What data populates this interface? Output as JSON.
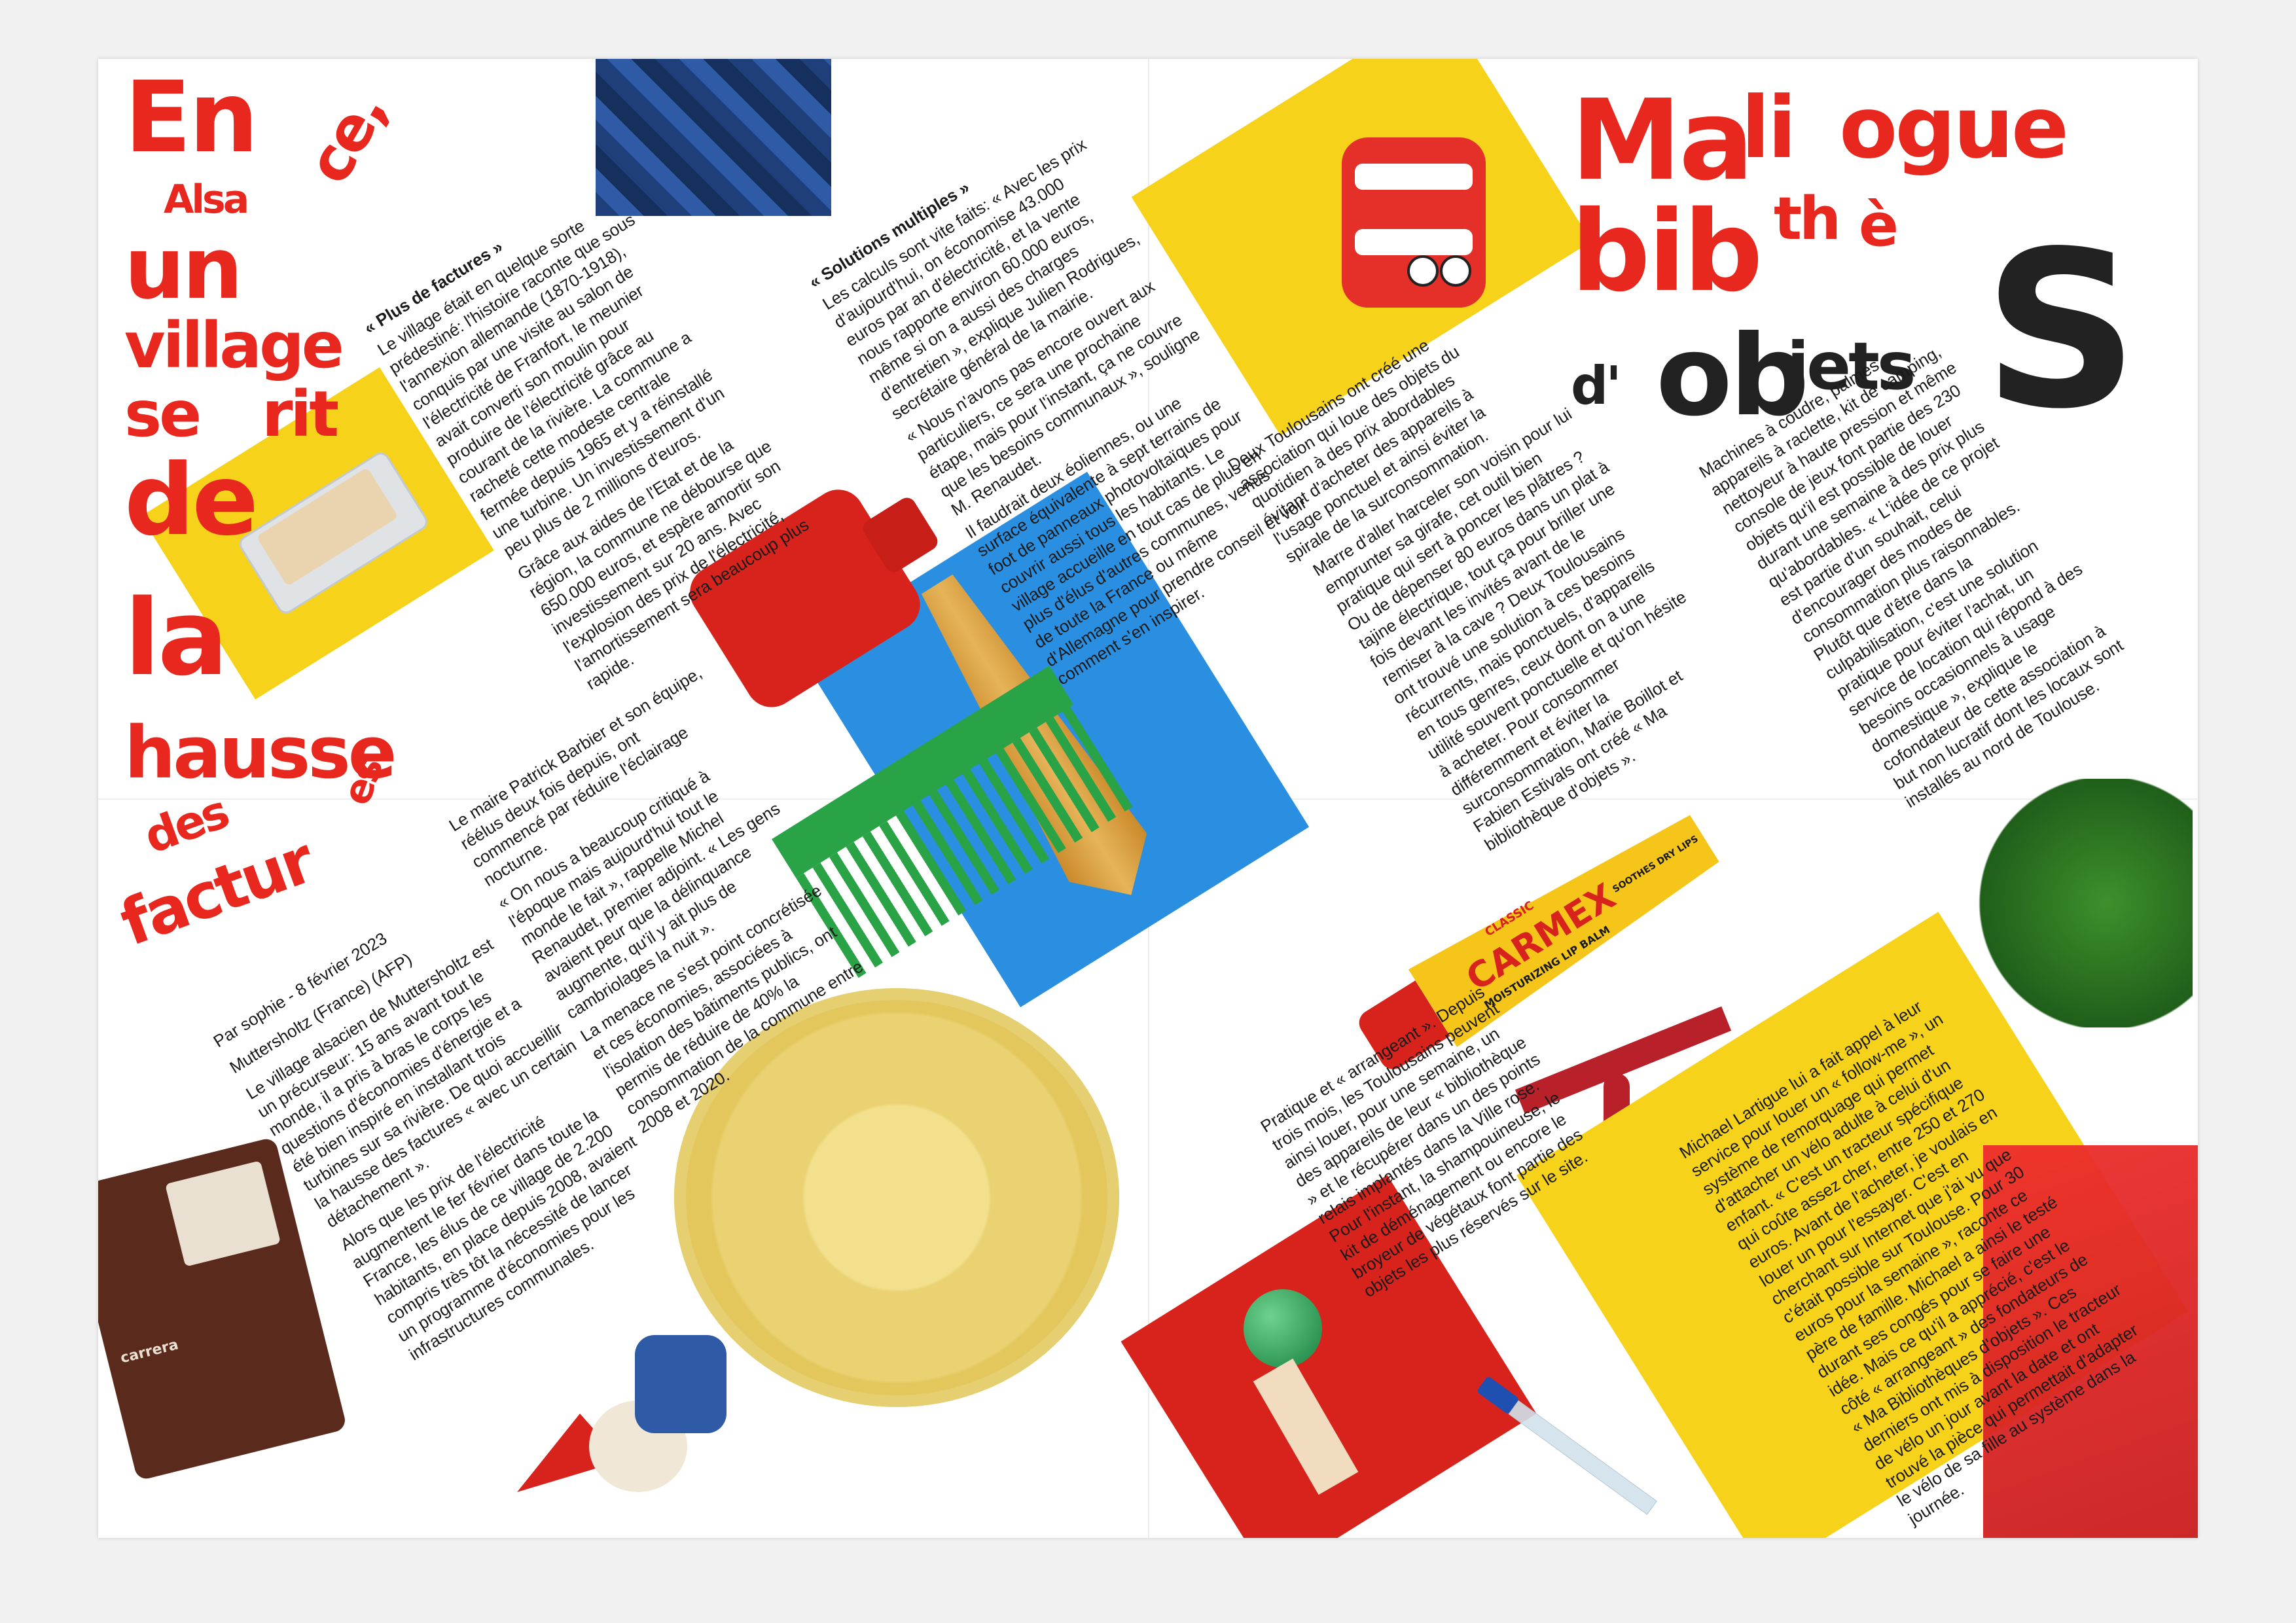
{
  "left_article": {
    "title_words": [
      "En",
      "Alsa",
      "ce,",
      "un",
      "village",
      "se",
      "rit",
      "de",
      "la",
      "hausse",
      "des",
      "factur",
      "es"
    ],
    "byline": "Par sophie - 8 février 2023",
    "dateline": "Muttersholtz (France) (AFP)",
    "col1": "Le village alsacien de Muttersholtz est un précurseur: 15 ans avant tout le monde, il a pris à bras le corps les questions d'économies d'énergie et a été bien inspiré en installant trois turbines sur sa rivière. De quoi accueillir la hausse des factures « avec un certain détachement ».",
    "col1b": "Alors que les prix de l'électricité augmentent le fer février dans toute la France, les élus de ce village de 2.200 habitants, en place depuis 2008, avaient compris très tôt la nécessité de lancer un programme d'économies pour les infrastructures communales.",
    "subhead1": "« Plus de factures »",
    "col2": "Le village était en quelque sorte prédestiné: l'histoire raconte que sous l'annexion allemande (1870-1918), conquis par une visite au salon de l'électricité de Franfort, le meunier avait converti son moulin pour produire de l'électricité grâce au courant de la rivière. La commune a racheté cette modeste centrale fermée depuis 1965 et y a réinstallé une turbine. Un investissement d'un peu plus de 2 millions d'euros.",
    "col2b": "Grâce aux aides de l'Etat et de la région, la commune ne débourse que 650.000 euros, et espère amortir son investissement sur 20 ans. Avec l'explosion des prix de l'électricité, l'amortissement sera beaucoup plus rapide.",
    "col3": "Le maire Patrick Barbier et son équipe, réélus deux fois depuis, ont commencé par réduire l'éclairage nocturne.",
    "col3b": "« On nous a beaucoup critiqué à l'époque mais aujourd'hui tout le monde le fait », rappelle Michel Renaudet, premier adjoint. « Les gens avaient peur que la délinquance augmente, qu'il y ait plus de cambriolages la nuit ».",
    "col3c": "La menace ne s'est point concrétisée et ces économies, associées à l'isolation des bâtiments publics, ont permis de réduire de 40% la consommation de la commune entre 2008 et 2020.",
    "subhead2": "« Solutions multiples »",
    "col4": "Les calculs sont vite faits: « Avec les prix d'aujourd'hui, on économise 43.000 euros par an d'électricité, et la vente nous rapporte environ 60.000 euros, même si on a aussi des charges d'entretien », explique Julien Rodrigues, secrétaire général de la mairie.",
    "col4b": "« Nous n'avons pas encore ouvert aux particuliers, ce sera une prochaine étape, mais pour l'instant, ça ne couvre que les besoins communaux », souligne M. Renaudet.",
    "col4c": "Il faudrait deux éoliennes, ou une surface équivalente à sept terrains de foot de panneaux photovoltaïques pour couvrir aussi tous les habitants. Le village accueille en tout cas de plus en plus d'élus d'autres communes, venus de toute la France ou même d'Allemagne pour prendre conseil et voir comment s'en inspirer."
  },
  "right_article": {
    "title_words": [
      "Ma",
      "li",
      "ogue",
      "bib",
      "th",
      "è",
      "d'",
      "ob",
      "jets",
      "S"
    ],
    "col1": "Deux Toulousains ont créé une association qui loue des objets du quotidien à des prix abordables évitant d'acheter des appareils à l'usage ponctuel et ainsi éviter la spirale de la surconsommation.",
    "col2": "Marre d'aller harceler son voisin pour lui emprunter sa girafe, cet outil bien pratique qui sert à poncer les plâtres ? Ou de dépenser 80 euros dans un plat à tajine électrique, tout ça pour briller une fois devant les invités avant de le remiser à la cave ? Deux Toulousains ont trouvé une solution à ces besoins récurrents, mais ponctuels, d'appareils en tous genres, ceux dont on a une utilité souvent ponctuelle et qu'on hésite à acheter. Pour consommer différemment et éviter la surconsommation, Marie Boillot et Fabien Estivals ont créé « Ma bibliothèque d'objets ».",
    "col3": "Machines à coudre, palmes, appareils à raclette, kit de camping, nettoyeur à haute pression et même console de jeux font partie des 230 objets qu'il est possible de louer durant une semaine à des prix plus qu'abordables. « L'idée de ce projet est partie d'un souhait, celui d'encourager des modes de consommation plus raisonnables. Plutôt que d'être dans la culpabilisation, c'est une solution pratique pour éviter l'achat, un service de location qui répond à des besoins occasionnels à usage domestique », explique le cofondateur de cette association à but non lucratif dont les locaux sont installés au nord de Toulouse.",
    "col4": "Pratique et « arrangeant ». Depuis trois mois, les Toulousains peuvent ainsi louer, pour une semaine, un des appareils de leur « bibliothèque » et le récupérer dans un des points relais implantés dans la Ville rose. Pour l'instant, la shampouineuse, le kit de déménagement ou encore le broyeur de végétaux font partie des objets les plus réservés sur le site.",
    "col5": "Michael Lartigue lui a fait appel à leur service pour louer un « follow-me », un système de remorquage qui permet d'attacher un vélo adulte à celui d'un enfant. « C'est un tracteur spécifique qui coûte assez cher, entre 250 et 270 euros. Avant de l'acheter, je voulais en louer un pour l'essayer. C'est en cherchant sur Internet que j'ai vu que c'était possible sur Toulouse. Pour 30 euros pour la semaine », raconte ce père de famille. Michael a ainsi le testé durant ses congés pour se faire une idée. Mais ce qu'il a apprécié, c'est le côté « arrangeant » des fondateurs de « Ma Bibliothèques d'objets ». Ces derniers ont mis à disposition le tracteur de vélo un jour avant la date et ont trouvé la pièce qui permettait d'adapter le vélo de sa fille au système dans la journée."
  },
  "product_labels": {
    "carmex_brand": "CARMEX",
    "carmex_classic": "CLASSIC",
    "carmex_tagline": "MOISTURIZING LIP BALM",
    "carmex_side": "SOOTHES DRY LIPS",
    "radio_brand": "carrera"
  },
  "colors": {
    "red": "#e8281e",
    "yellow": "#f6d21a",
    "blue": "#2a8fe0",
    "green": "#29a345",
    "ink": "#1a1a1a"
  }
}
